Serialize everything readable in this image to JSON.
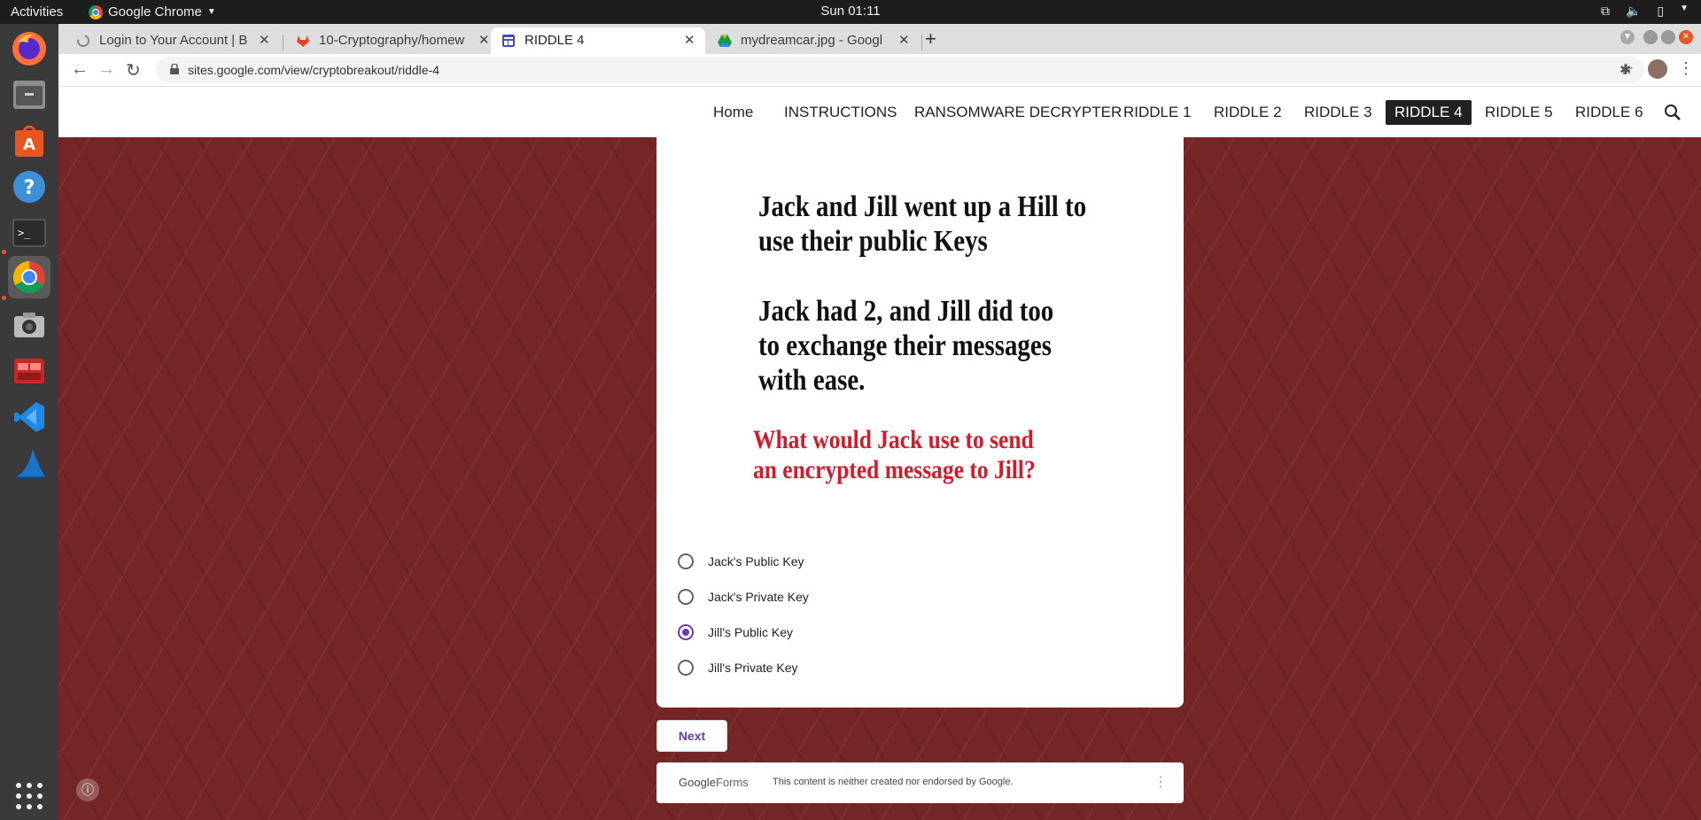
{
  "topbar": {
    "activities": "Activities",
    "app_name": "Google Chrome",
    "clock": "Sun 01:11"
  },
  "dock": {
    "apps": [
      "firefox-icon",
      "files-icon",
      "software-icon",
      "help-icon",
      "terminal-icon",
      "chrome-icon",
      "screenshot-icon",
      "remmina-icon",
      "vscode-icon",
      "wireshark-icon",
      "app-grid-icon"
    ]
  },
  "tabs": [
    {
      "label": "Login to Your Account | B"
    },
    {
      "label": "10-Cryptography/homew"
    },
    {
      "label": "RIDDLE 4"
    },
    {
      "label": "mydreamcar.jpg - Googl"
    }
  ],
  "toolbar": {
    "url": "sites.google.com/view/cryptobreakout/riddle-4"
  },
  "site_nav": {
    "items": [
      "Home",
      "INSTRUCTIONS",
      "RANSOMWARE DECRYPTER",
      "RIDDLE 1",
      "RIDDLE 2",
      "RIDDLE 3",
      "RIDDLE 4",
      "RIDDLE 5",
      "RIDDLE 6"
    ],
    "current": "RIDDLE 4"
  },
  "riddle": {
    "lines": [
      "Jack and Jill went up a Hill to",
      "use their public Keys",
      "Jack had 2, and Jill did too",
      "to exchange their messages",
      "with ease."
    ],
    "question": [
      "What would Jack use to send",
      "an encrypted message to Jill?"
    ]
  },
  "form": {
    "options": [
      {
        "label": "Jack's Public Key",
        "checked": false
      },
      {
        "label": "Jack's Private Key",
        "checked": false
      },
      {
        "label": "Jill's Public Key",
        "checked": true
      },
      {
        "label": "Jill's Private Key",
        "checked": false
      }
    ],
    "next_label": "Next",
    "footer_brand_1": "Google",
    "footer_brand_2": "Forms",
    "footer_notice": "This content is neither created nor endorsed by Google."
  },
  "colors": {
    "accent": "#673ab7",
    "background": "#742525",
    "question": "#d7192a"
  }
}
